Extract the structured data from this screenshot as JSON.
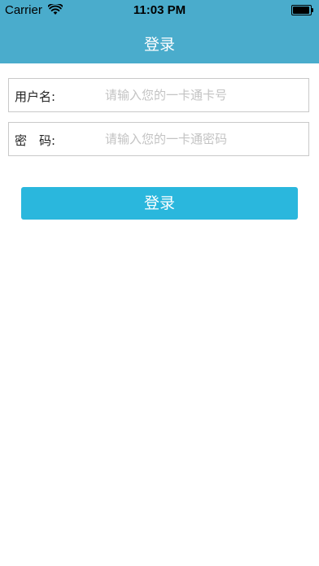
{
  "status_bar": {
    "carrier": "Carrier",
    "time": "11:03 PM",
    "wifi_icon": "wifi-icon",
    "battery_icon": "battery-icon"
  },
  "nav": {
    "title": "登录",
    "background": "#4aaccc"
  },
  "form": {
    "username": {
      "label": "用户名:",
      "placeholder": "请输入您的一卡通卡号",
      "value": ""
    },
    "password": {
      "label": "密　码:",
      "placeholder": "请输入您的一卡通密码",
      "value": ""
    }
  },
  "login_button": {
    "label": "登录",
    "color": "#2ab7dd"
  }
}
